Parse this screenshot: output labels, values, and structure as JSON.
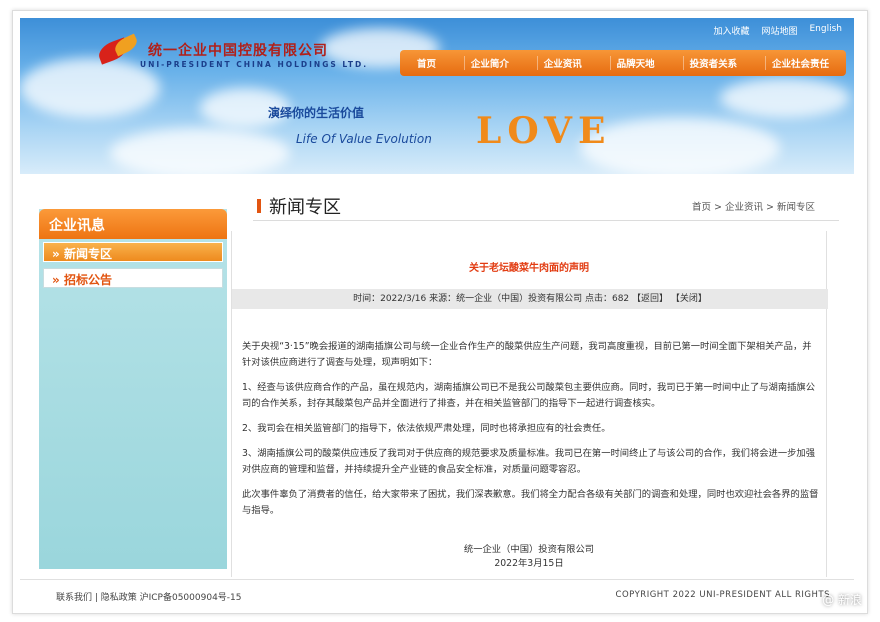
{
  "header": {
    "top_links": [
      "加入收藏",
      "网站地图",
      "English"
    ],
    "logo_cn": "统一企业中国控股有限公司",
    "logo_en": "UNI-PRESIDENT CHINA HOLDINGS LTD.",
    "nav": [
      "首页",
      "企业简介",
      "企业资讯",
      "品牌天地",
      "投资者关系",
      "企业社会责任"
    ],
    "slogan_cn": "演绎你的生活价值",
    "slogan_en": "Life Of Value Evolution",
    "love": "LOVE"
  },
  "sidebar": {
    "title": "企业讯息",
    "items": [
      {
        "label": "新闻专区",
        "active": true
      },
      {
        "label": "招标公告",
        "active": false
      }
    ]
  },
  "main": {
    "title": "新闻专区",
    "breadcrumb": "首页 > 企业资讯 > 新闻专区",
    "headline": "关于老坛酸菜牛肉面的声明",
    "meta": "时间：2022/3/16  来源：统一企业（中国）投资有限公司  点击：682  【返回】 【关闭】",
    "paragraphs": [
      "关于央视“3·15”晚会报道的湖南插旗公司与统一企业合作生产的酸菜供应生产问题，我司高度重视，目前已第一时间全面下架相关产品，并针对该供应商进行了调查与处理，现声明如下：",
      "1、经查与该供应商合作的产品，虽在规范内，湖南插旗公司已不是我公司酸菜包主要供应商。同时，我司已于第一时间中止了与湖南插旗公司的合作关系，封存其酸菜包产品并全面进行了排查，并在相关监管部门的指导下一起进行调查核实。",
      "2、我司会在相关监管部门的指导下，依法依规严肃处理，同时也将承担应有的社会责任。",
      "3、湖南插旗公司的酸菜供应违反了我司对于供应商的规范要求及质量标准。我司已在第一时间终止了与该公司的合作，我们将会进一步加强对供应商的管理和监督，并持续提升全产业链的食品安全标准，对质量问题零容忍。",
      "此次事件辜负了消费者的信任，给大家带来了困扰，我们深表歉意。我们将全力配合各级有关部门的调查和处理，同时也欢迎社会各界的监督与指导。"
    ],
    "signature": "统一企业（中国）投资有限公司",
    "date": "2022年3月15日"
  },
  "footer": {
    "left": "联系我们 | 隐私政策  沪ICP备05000904号-15",
    "right": "COPYRIGHT 2022 UNI-PRESIDENT ALL RIGHTS"
  },
  "watermark": "@ 新浪"
}
